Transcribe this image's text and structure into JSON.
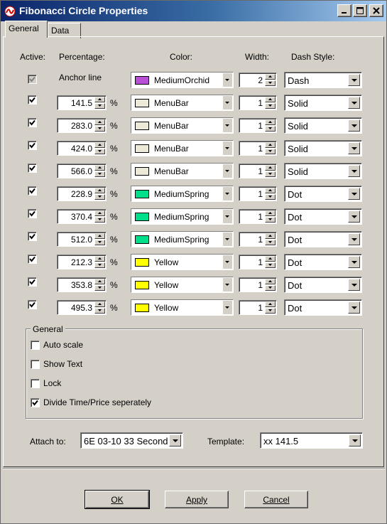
{
  "window": {
    "title": "Fibonacci Circle Properties"
  },
  "tabs": [
    {
      "label": "General",
      "active": true
    },
    {
      "label": "Data",
      "active": false
    }
  ],
  "headers": {
    "active": "Active:",
    "percentage": "Percentage:",
    "color": "Color:",
    "width": "Width:",
    "dash_style": "Dash Style:"
  },
  "anchor": {
    "label": "Anchor line",
    "active": true,
    "color_name": "MediumOrchid",
    "color_hex": "#b84fd6",
    "width": "2",
    "dash": "Dash"
  },
  "levels": [
    {
      "active": true,
      "percent": "141.5",
      "color_name": "MenuBar",
      "color_hex": "#ece9d8",
      "width": "1",
      "dash": "Solid"
    },
    {
      "active": true,
      "percent": "283.0",
      "color_name": "MenuBar",
      "color_hex": "#ece9d8",
      "width": "1",
      "dash": "Solid"
    },
    {
      "active": true,
      "percent": "424.0",
      "color_name": "MenuBar",
      "color_hex": "#ece9d8",
      "width": "1",
      "dash": "Solid"
    },
    {
      "active": true,
      "percent": "566.0",
      "color_name": "MenuBar",
      "color_hex": "#ece9d8",
      "width": "1",
      "dash": "Solid"
    },
    {
      "active": true,
      "percent": "228.9",
      "color_name": "MediumSpring",
      "color_hex": "#00e08a",
      "width": "1",
      "dash": "Dot"
    },
    {
      "active": true,
      "percent": "370.4",
      "color_name": "MediumSpring",
      "color_hex": "#00e08a",
      "width": "1",
      "dash": "Dot"
    },
    {
      "active": true,
      "percent": "512.0",
      "color_name": "MediumSpring",
      "color_hex": "#00e08a",
      "width": "1",
      "dash": "Dot"
    },
    {
      "active": true,
      "percent": "212.3",
      "color_name": "Yellow",
      "color_hex": "#ffff00",
      "width": "1",
      "dash": "Dot"
    },
    {
      "active": true,
      "percent": "353.8",
      "color_name": "Yellow",
      "color_hex": "#ffff00",
      "width": "1",
      "dash": "Dot"
    },
    {
      "active": true,
      "percent": "495.3",
      "color_name": "Yellow",
      "color_hex": "#ffff00",
      "width": "1",
      "dash": "Dot"
    }
  ],
  "percent_sign": "%",
  "general_group": {
    "title": "General",
    "options": [
      {
        "label": "Auto scale",
        "checked": false
      },
      {
        "label": "Show Text",
        "checked": false
      },
      {
        "label": "Lock",
        "checked": false
      },
      {
        "label": "Divide Time/Price seperately",
        "checked": true
      }
    ]
  },
  "attach": {
    "label": "Attach to:",
    "value": "6E 03-10 33 Second"
  },
  "template": {
    "label": "Template:",
    "value": "xx 141.5"
  },
  "buttons": {
    "ok": "OK",
    "apply": "Apply",
    "cancel": "Cancel"
  }
}
